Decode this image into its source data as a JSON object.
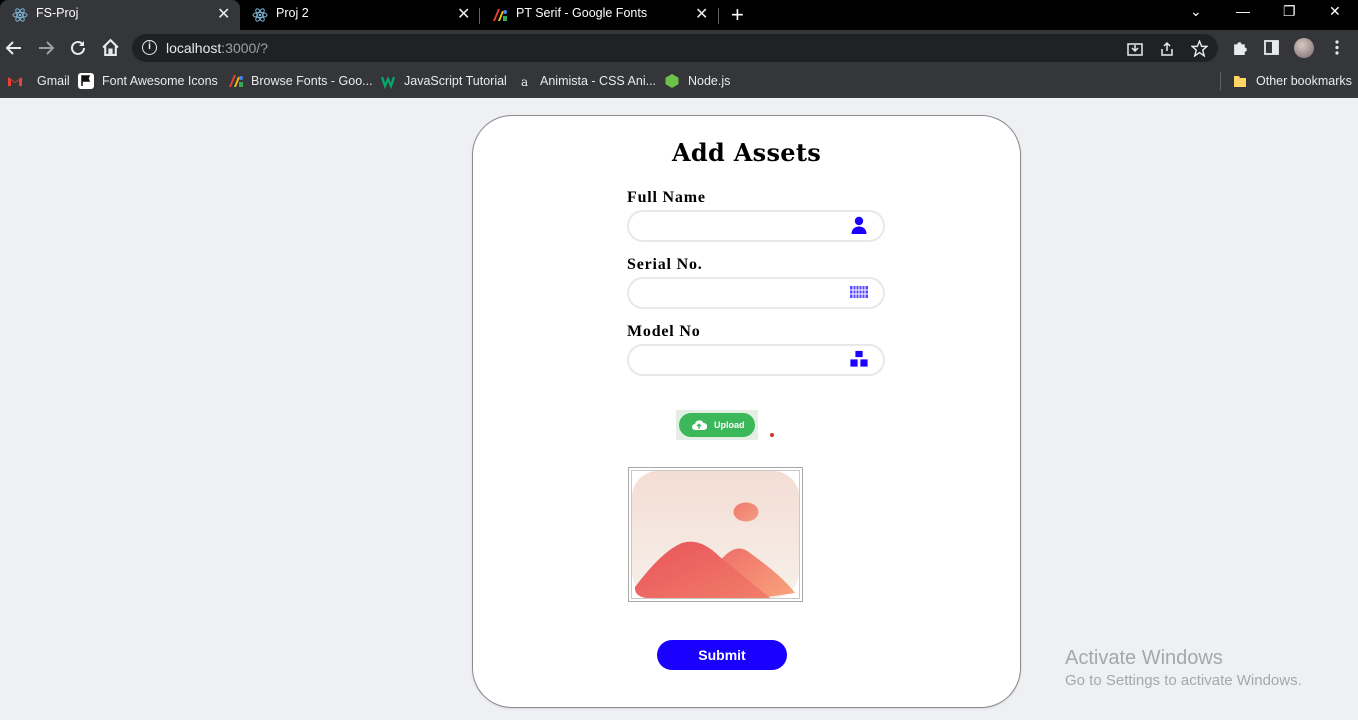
{
  "browser": {
    "tabs": [
      {
        "title": "FS-Proj",
        "icon": "react-icon",
        "active": true
      },
      {
        "title": "Proj 2",
        "icon": "react-icon",
        "active": false
      },
      {
        "title": "PT Serif - Google Fonts",
        "icon": "google-fonts-icon",
        "active": false
      }
    ],
    "close_glyph": "✕",
    "new_tab_glyph": "+",
    "window_controls": {
      "dropdown": "⌄",
      "minimize": "—",
      "restore": "❐",
      "close": "✕"
    },
    "url_host": "localhost",
    "url_rest": ":3000/?",
    "bookmarks": [
      {
        "label": "Gmail",
        "icon": "gmail-icon"
      },
      {
        "label": "Font Awesome Icons",
        "icon": "flag-icon"
      },
      {
        "label": "Browse Fonts - Goo...",
        "icon": "google-fonts-icon"
      },
      {
        "label": "JavaScript Tutorial",
        "icon": "w3schools-icon"
      },
      {
        "label": "Animista - CSS Ani...",
        "icon": "animista-icon"
      },
      {
        "label": "Node.js",
        "icon": "nodejs-icon"
      }
    ],
    "other_bookmarks": "Other bookmarks"
  },
  "form": {
    "title": "Add Assets",
    "fields": [
      {
        "label": "Full Name",
        "value": "",
        "icon": "user-icon"
      },
      {
        "label": "Serial No.",
        "value": "",
        "icon": "barcode-icon"
      },
      {
        "label": "Model No",
        "value": "",
        "icon": "cubes-icon"
      }
    ],
    "upload_label": "Upload",
    "submit_label": "Submit"
  },
  "watermark": {
    "line1": "Activate Windows",
    "line2": "Go to Settings to activate Windows."
  },
  "colors": {
    "accent": "#1a00ff",
    "icon_blue": "#1a00ff",
    "upload_green": "#3cb85a"
  }
}
